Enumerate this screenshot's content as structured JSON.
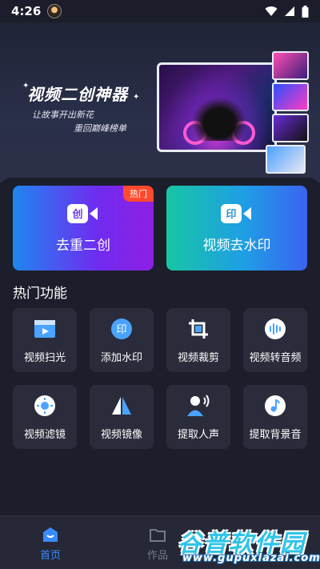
{
  "status_bar": {
    "time": "4:26",
    "icons": [
      "wifi-icon",
      "signal-icon",
      "battery-icon"
    ]
  },
  "hero": {
    "title": "视频二创神器",
    "subtitle_line1": "让故事开出新花",
    "subtitle_line2": "重回巅峰榜单"
  },
  "feature_cards": [
    {
      "label": "去重二创",
      "icon_char": "创",
      "badge": "热门"
    },
    {
      "label": "视频去水印",
      "icon_char": "印"
    }
  ],
  "section_title": "热门功能",
  "tools": [
    {
      "label": "视频扫光",
      "icon": "video-scan-icon"
    },
    {
      "label": "添加水印",
      "icon": "add-watermark-icon"
    },
    {
      "label": "视频裁剪",
      "icon": "crop-icon"
    },
    {
      "label": "视频转音频",
      "icon": "audio-wave-icon"
    },
    {
      "label": "视频滤镜",
      "icon": "filter-icon"
    },
    {
      "label": "视频镜像",
      "icon": "mirror-icon"
    },
    {
      "label": "提取人声",
      "icon": "voice-extract-icon"
    },
    {
      "label": "提取背景音",
      "icon": "music-note-icon"
    }
  ],
  "bottom_nav": [
    {
      "label": "首页",
      "icon": "home-icon",
      "active": true
    },
    {
      "label": "作品",
      "icon": "folder-icon",
      "active": false
    }
  ],
  "watermark": {
    "main": "谷普软件园",
    "url": "www.gupuxlazal.com"
  },
  "colors": {
    "accent": "#3a8bff",
    "hot_badge": "#ff4a2e",
    "panel_bg": "#1c1e2b",
    "tool_bg": "#2a2c3b"
  }
}
